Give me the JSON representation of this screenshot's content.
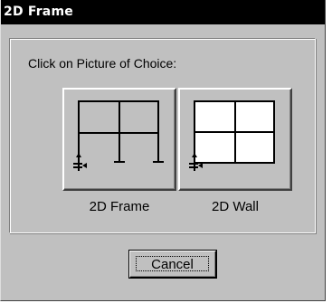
{
  "window": {
    "title": "2D Frame"
  },
  "group": {
    "label": "Click on Picture of Choice:"
  },
  "choices": [
    {
      "label": "2D Frame",
      "icon": "frame-structure-icon"
    },
    {
      "label": "2D Wall",
      "icon": "wall-structure-icon"
    }
  ],
  "buttons": {
    "cancel_label": "Cancel"
  },
  "colors": {
    "dialog_bg": "#c0c0c0",
    "titlebar_bg": "#000000",
    "titlebar_text": "#ffffff",
    "wall_fill": "#ffffff"
  }
}
